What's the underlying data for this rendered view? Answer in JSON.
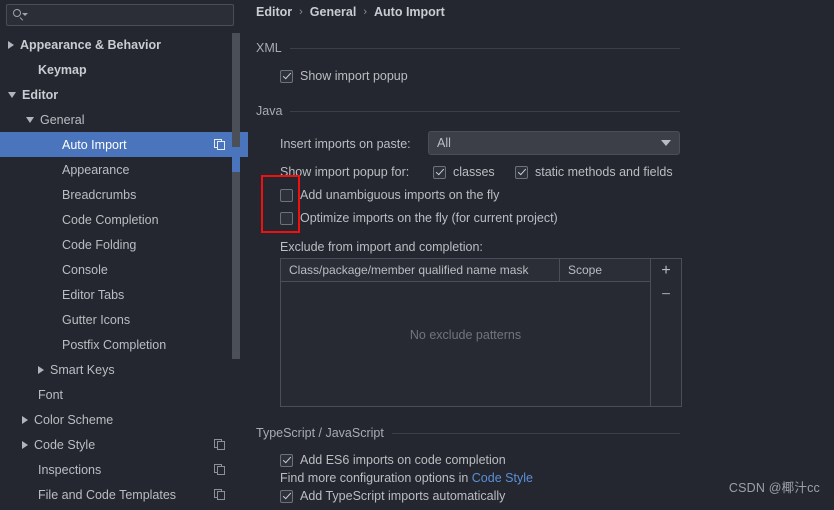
{
  "search": {
    "value": "",
    "placeholder": "",
    "icon": "search-icon"
  },
  "sidebar": {
    "items": [
      {
        "label": "Appearance & Behavior",
        "twisty": "collapsed",
        "indent": 8,
        "bold": true,
        "selected": false,
        "icon": null
      },
      {
        "label": "Keymap",
        "twisty": "none",
        "indent": 26,
        "bold": true,
        "selected": false,
        "icon": null
      },
      {
        "label": "Editor",
        "twisty": "expanded",
        "indent": 8,
        "bold": true,
        "selected": false,
        "icon": null
      },
      {
        "label": "General",
        "twisty": "expanded",
        "indent": 26,
        "bold": false,
        "selected": false,
        "icon": null
      },
      {
        "label": "Auto Import",
        "twisty": "none",
        "indent": 50,
        "bold": false,
        "selected": true,
        "icon": "copy-icon"
      },
      {
        "label": "Appearance",
        "twisty": "none",
        "indent": 50,
        "bold": false,
        "selected": false,
        "icon": null
      },
      {
        "label": "Breadcrumbs",
        "twisty": "none",
        "indent": 50,
        "bold": false,
        "selected": false,
        "icon": null
      },
      {
        "label": "Code Completion",
        "twisty": "none",
        "indent": 50,
        "bold": false,
        "selected": false,
        "icon": null
      },
      {
        "label": "Code Folding",
        "twisty": "none",
        "indent": 50,
        "bold": false,
        "selected": false,
        "icon": null
      },
      {
        "label": "Console",
        "twisty": "none",
        "indent": 50,
        "bold": false,
        "selected": false,
        "icon": null
      },
      {
        "label": "Editor Tabs",
        "twisty": "none",
        "indent": 50,
        "bold": false,
        "selected": false,
        "icon": null
      },
      {
        "label": "Gutter Icons",
        "twisty": "none",
        "indent": 50,
        "bold": false,
        "selected": false,
        "icon": null
      },
      {
        "label": "Postfix Completion",
        "twisty": "none",
        "indent": 50,
        "bold": false,
        "selected": false,
        "icon": null
      },
      {
        "label": "Smart Keys",
        "twisty": "collapsed",
        "indent": 38,
        "bold": false,
        "selected": false,
        "icon": null
      },
      {
        "label": "Font",
        "twisty": "none",
        "indent": 26,
        "bold": false,
        "selected": false,
        "icon": null
      },
      {
        "label": "Color Scheme",
        "twisty": "collapsed",
        "indent": 22,
        "bold": false,
        "selected": false,
        "icon": null
      },
      {
        "label": "Code Style",
        "twisty": "collapsed",
        "indent": 22,
        "bold": false,
        "selected": false,
        "icon": "copy-icon"
      },
      {
        "label": "Inspections",
        "twisty": "none",
        "indent": 26,
        "bold": false,
        "selected": false,
        "icon": "copy-icon"
      },
      {
        "label": "File and Code Templates",
        "twisty": "none",
        "indent": 26,
        "bold": false,
        "selected": false,
        "icon": "copy-icon"
      }
    ]
  },
  "breadcrumb": {
    "part1": "Editor",
    "sep1": "›",
    "part2": "General",
    "sep2": "›",
    "part3": "Auto Import"
  },
  "sections": {
    "xml": {
      "title": "XML",
      "show_import_popup": {
        "label": "Show import popup",
        "checked": true
      }
    },
    "java": {
      "title": "Java",
      "insert_imports_label": "Insert imports on paste:",
      "insert_imports_value": "All",
      "show_popup_for_label": "Show import popup for:",
      "classes": {
        "label": "classes",
        "checked": true
      },
      "static_methods": {
        "label": "static methods and fields",
        "checked": true
      },
      "add_unambiguous": {
        "label": "Add unambiguous imports on the fly",
        "checked": false
      },
      "optimize_imports": {
        "label": "Optimize imports on the fly (for current project)",
        "checked": false
      },
      "exclude_label": "Exclude from import and completion:",
      "table": {
        "columns": [
          "Class/package/member qualified name mask",
          "Scope"
        ],
        "rows": [],
        "empty_text": "No exclude patterns",
        "add_button": "+",
        "remove_button": "−"
      }
    },
    "ts_js": {
      "title": "TypeScript / JavaScript",
      "es6": {
        "label": "Add ES6 imports on code completion",
        "checked": true
      },
      "hint_prefix": "Find more configuration options in ",
      "hint_link": "Code Style",
      "ts_auto": {
        "label": "Add TypeScript imports automatically",
        "checked": true
      }
    }
  },
  "highlight": {
    "color": "#f01010"
  },
  "watermark": {
    "text": "CSDN @椰汁cc"
  },
  "colors": {
    "background": "#242730",
    "selection": "#4a75bd",
    "link": "#5b8fd6",
    "border": "#4a4e57"
  }
}
